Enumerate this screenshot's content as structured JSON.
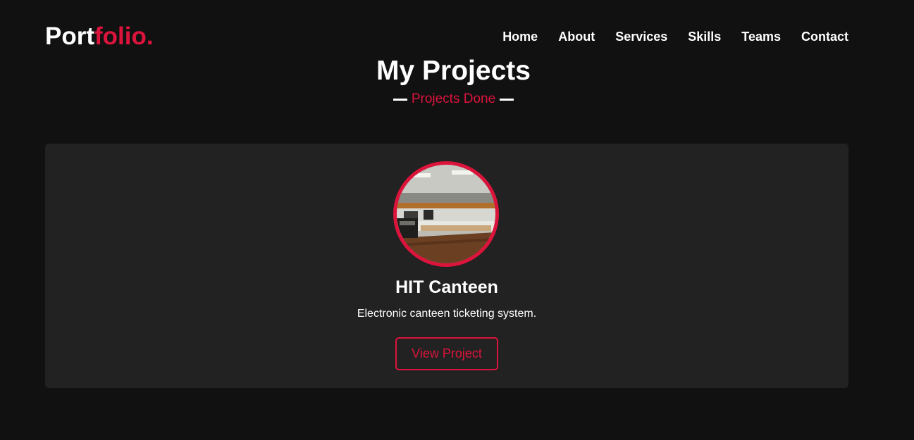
{
  "brand": {
    "logo_part1": "Port",
    "logo_part2": "folio.",
    "accent_color": "#dc143c"
  },
  "nav": {
    "items": [
      {
        "label": "Home"
      },
      {
        "label": "About"
      },
      {
        "label": "Services"
      },
      {
        "label": "Skills"
      },
      {
        "label": "Teams"
      },
      {
        "label": "Contact"
      }
    ]
  },
  "section": {
    "title": "My Projects",
    "subtitle": "Projects Done"
  },
  "project": {
    "name": "HIT Canteen",
    "description": "Electronic canteen ticketing system.",
    "button_label": "View Project",
    "image_alt_icon": "canteen-photo"
  },
  "colors": {
    "background": "#111111",
    "card": "#222222",
    "accent": "#dc143c",
    "text": "#ffffff"
  }
}
